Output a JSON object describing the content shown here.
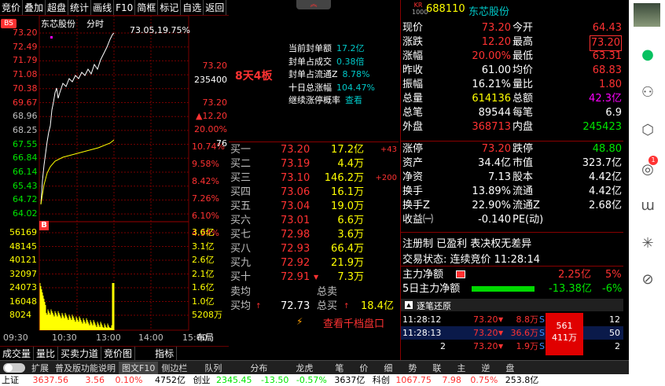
{
  "menu": [
    "竞价",
    "叠加",
    "超盘",
    "统计",
    "画线",
    "F10",
    "简框",
    "标记",
    "自选",
    "返回"
  ],
  "chart": {
    "stock_name": "东芯股份",
    "period": "分时",
    "badge": "BS",
    "peak_label": "73.05,19.75%",
    "price_ticks": [
      "73.20",
      "72.49",
      "71.79",
      "71.08",
      "70.38",
      "69.67",
      "68.96",
      "68.25",
      "67.55",
      "66.84",
      "66.14",
      "65.43",
      "64.72",
      "64.02"
    ],
    "pct_ticks": [
      "10.74%",
      "9.58%",
      "8.42%",
      "7.26%",
      "6.10%",
      "4.94%"
    ],
    "right_info": [
      "73.20",
      "235400",
      "73.20",
      "▲12.20",
      "20.00%",
      "76"
    ],
    "vol_ticks": [
      "56169",
      "48145",
      "40121",
      "32097",
      "24073",
      "16048",
      "8024"
    ],
    "vol_right": [
      "3.6亿",
      "3.1亿",
      "2.6亿",
      "2.1亿",
      "1.6亿",
      "1.0亿",
      "5208万"
    ],
    "time_ticks": [
      "09:30",
      "10:30",
      "13:00",
      "14:00",
      "15:00"
    ],
    "layout_label": "布局",
    "b_marker": "B",
    "colors": {
      "price": "#ffffff",
      "avg": "#ffff00",
      "vol": "#ffff00"
    }
  },
  "bottom_left_tabs": [
    "成交量",
    "量比",
    "买卖力道",
    "竞价图",
    "指标"
  ],
  "mid": {
    "board_text": "8天4板",
    "seal_rows": [
      {
        "label": "当前封单额",
        "value": "17.2亿"
      },
      {
        "label": "封单占成交",
        "value": "0.38倍"
      },
      {
        "label": "封单占流通Z",
        "value": "8.78%"
      },
      {
        "label": "十日总涨幅",
        "value": "104.47%"
      },
      {
        "label": "继续涨停概率",
        "value": "查看"
      }
    ]
  },
  "book": {
    "buys": [
      {
        "label": "买一",
        "price": "73.20",
        "vol": "17.2亿",
        "extra": "+43"
      },
      {
        "label": "买二",
        "price": "73.19",
        "vol": "4.4万",
        "extra": ""
      },
      {
        "label": "买三",
        "price": "73.10",
        "vol": "146.2万",
        "extra": "+200"
      },
      {
        "label": "买四",
        "price": "73.06",
        "vol": "16.1万",
        "extra": ""
      },
      {
        "label": "买五",
        "price": "73.04",
        "vol": "19.0万",
        "extra": ""
      },
      {
        "label": "买六",
        "price": "73.01",
        "vol": "6.6万",
        "extra": ""
      },
      {
        "label": "买七",
        "price": "72.98",
        "vol": "3.6万",
        "extra": ""
      },
      {
        "label": "买八",
        "price": "72.93",
        "vol": "66.4万",
        "extra": ""
      },
      {
        "label": "买九",
        "price": "72.92",
        "vol": "21.9万",
        "extra": ""
      },
      {
        "label": "买十",
        "price": "72.91",
        "vol": "7.3万",
        "extra": ""
      }
    ],
    "sell_avg_label": "卖均",
    "sell_total_label": "总卖",
    "buy_avg_label": "买均",
    "buy_avg": "72.73",
    "buy_total_label": "总买",
    "buy_total": "18.4亿",
    "link": "查看千档盘口"
  },
  "quote": {
    "code": "688110",
    "name": "东芯股份",
    "kr": "KR",
    "rows": [
      {
        "l1": "现价",
        "v1": "73.20",
        "c1": "red",
        "l2": "今开",
        "v2": "64.43",
        "c2": "red"
      },
      {
        "l1": "涨跌",
        "v1": "12.20",
        "c1": "red",
        "l2": "最高",
        "v2": "73.20",
        "c2": "red"
      },
      {
        "l1": "涨幅",
        "v1": "20.00%",
        "c1": "red",
        "l2": "最低",
        "v2": "63.31",
        "c2": "red"
      },
      {
        "l1": "昨收",
        "v1": "61.00",
        "c1": "white",
        "l2": "均价",
        "v2": "68.83",
        "c2": "red"
      },
      {
        "l1": "振幅",
        "v1": "16.21%",
        "c1": "white",
        "l2": "量比",
        "v2": "1.80",
        "c2": "red"
      },
      {
        "l1": "总量",
        "v1": "614136",
        "c1": "yellow",
        "l2": "总额",
        "v2": "42.3亿",
        "c2": "mag"
      },
      {
        "l1": "总笔",
        "v1": "89544",
        "c1": "white",
        "l2": "每笔",
        "v2": "6.9",
        "c2": "white"
      },
      {
        "l1": "外盘",
        "v1": "368713",
        "c1": "red",
        "l2": "内盘",
        "v2": "245423",
        "c2": "green"
      }
    ],
    "rows2": [
      {
        "l1": "涨停",
        "v1": "73.20",
        "c1": "red",
        "l2": "跌停",
        "v2": "48.80",
        "c2": "green"
      },
      {
        "l1": "资产",
        "v1": "34.4亿",
        "c1": "white",
        "l2": "市值",
        "v2": "323.7亿",
        "c2": "white"
      },
      {
        "l1": "净资",
        "v1": "7.13",
        "c1": "white",
        "l2": "股本",
        "v2": "4.42亿",
        "c2": "white"
      },
      {
        "l1": "换手",
        "v1": "13.89%",
        "c1": "white",
        "l2": "流通",
        "v2": "4.42亿",
        "c2": "white"
      },
      {
        "l1": "换手Z",
        "v1": "22.90%",
        "c1": "white",
        "l2": "流通Z",
        "v2": "2.68亿",
        "c2": "white"
      },
      {
        "l1": "收益㈠",
        "v1": "-0.140",
        "c1": "white",
        "l2": "PE(动)",
        "v2": "",
        "c2": "white"
      }
    ],
    "reg_text": "注册制 已盈利 表决权无差异",
    "trade_status": "交易状态: 连续竞价 11:28:14",
    "main_flow": {
      "label": "主力净额",
      "value": "2.25亿",
      "pct": "5%"
    },
    "main_flow5": {
      "label": "5日主力净额",
      "value": "-13.38亿",
      "pct": "-6%"
    },
    "tick_title": "逐笔还原",
    "ticks": [
      {
        "time": "11:28:12",
        "price": "73.20",
        "vol": "8.8万",
        "flag": "S",
        "n": "12"
      },
      {
        "time": "11:28:13",
        "price": "73.20",
        "vol": "36.6万",
        "flag": "S",
        "n": "50"
      },
      {
        "time": "2",
        "price": "73.20",
        "vol": "1.9万",
        "flag": "S",
        "n": "2"
      }
    ],
    "tick_box": [
      "561",
      "411万"
    ]
  },
  "bottom_tabs": [
    "扩展",
    "普及版功能说明",
    "图文F10",
    "侧边栏",
    "队列",
    "分布",
    "龙虎",
    "笔",
    "价",
    "细",
    "势",
    "联",
    "主",
    "逆",
    "盘"
  ],
  "status": {
    "idx1_name": "上证",
    "idx1_val": "3637.56",
    "idx1_chg": "3.56",
    "idx1_pct": "0.10%",
    "idx1_amt": "4752亿",
    "idx2_name": "创业",
    "idx2_val": "2345.45",
    "idx2_chg": "-13.50",
    "idx2_pct": "-0.57%",
    "idx2_amt": "3637亿",
    "idx3_name": "科创",
    "idx3_val": "1067.75",
    "idx3_chg": "7.98",
    "idx3_pct": "0.75%",
    "idx3_amt": "253.8亿"
  },
  "sidebar_icons": [
    "avatar",
    "chat-icon",
    "user-icon",
    "cube-icon",
    "aperture-icon",
    "butterfly-icon",
    "sparkle-icon",
    "link-icon"
  ],
  "sidebar_badge": "1"
}
